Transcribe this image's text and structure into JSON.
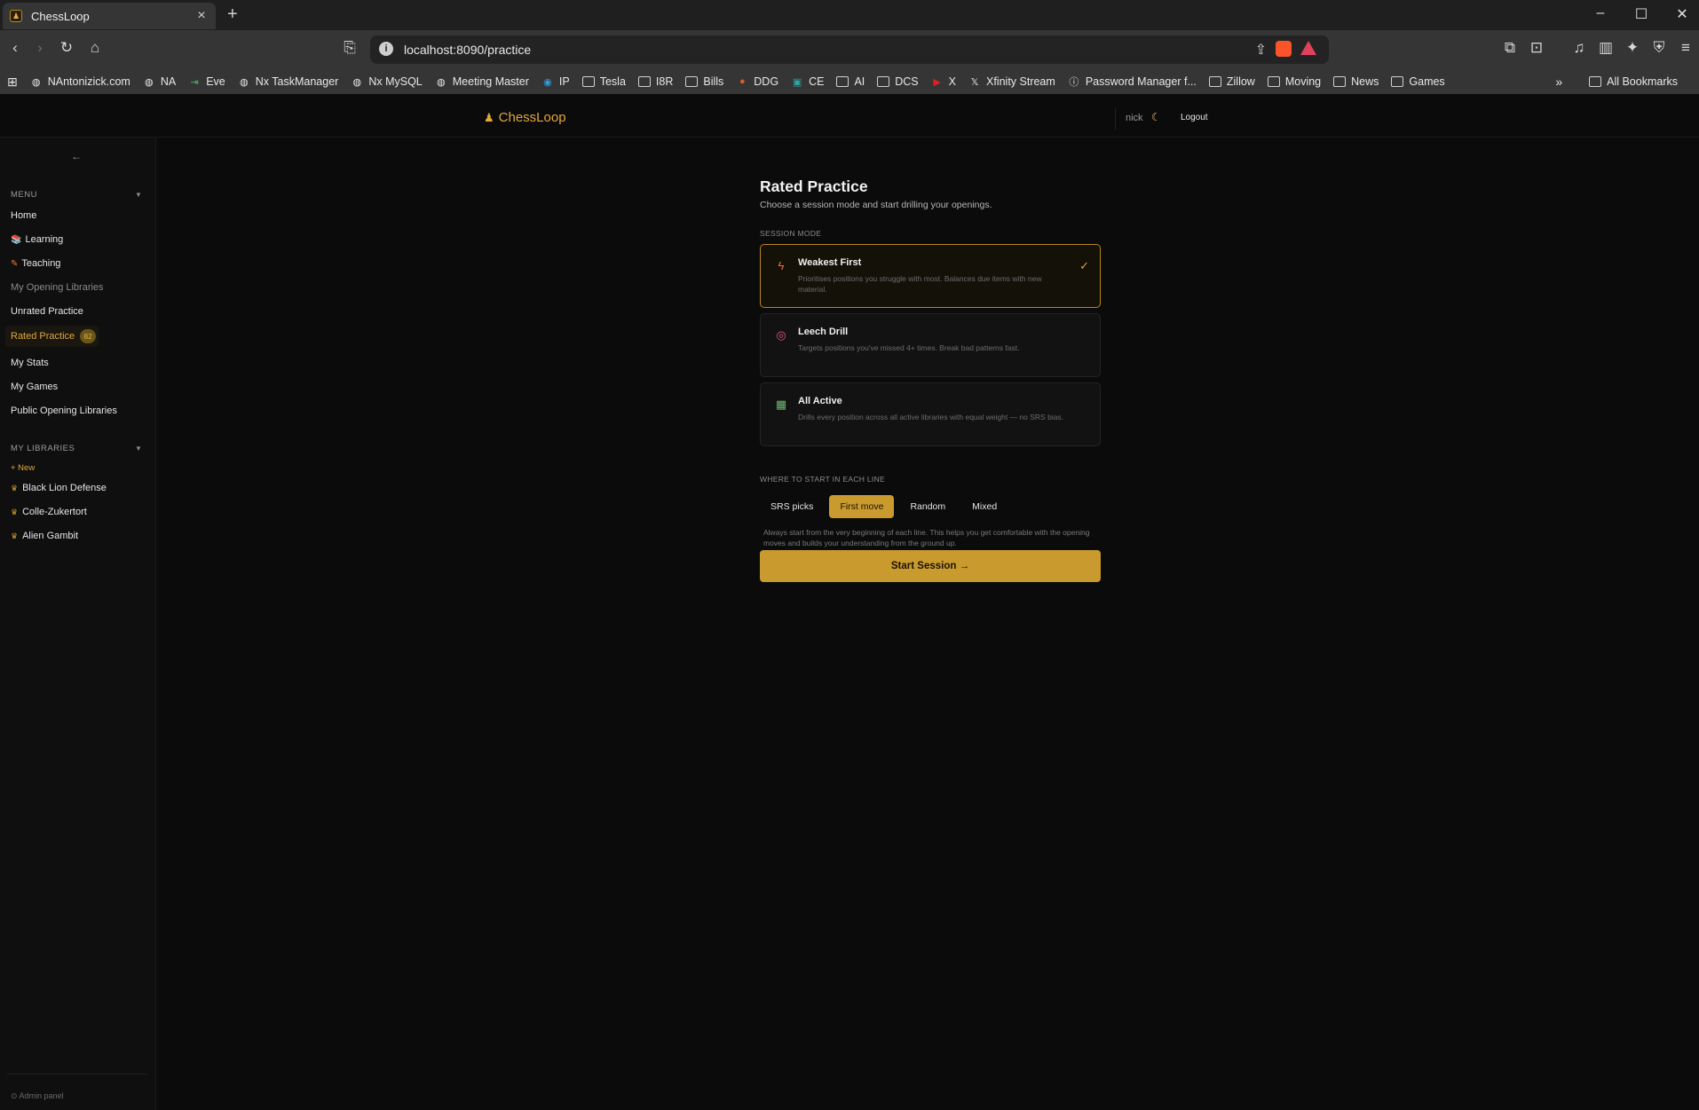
{
  "browser": {
    "tab_title": "ChessLoop",
    "url": "localhost:8090/practice",
    "bookmarks": [
      {
        "label": "NAntonizick.com",
        "icon": "globe-icon"
      },
      {
        "label": "NA",
        "icon": "globe-icon"
      },
      {
        "label": "Eve",
        "icon": "link-icon"
      },
      {
        "label": "Nx TaskManager",
        "icon": "globe-icon"
      },
      {
        "label": "Nx MySQL",
        "icon": "globe-icon"
      },
      {
        "label": "Meeting Master",
        "icon": "globe-icon"
      },
      {
        "label": "IP",
        "icon": "location-icon"
      },
      {
        "label": "Tesla",
        "icon": "folder-icon"
      },
      {
        "label": "I8R",
        "icon": "folder-icon"
      },
      {
        "label": "Bills",
        "icon": "folder-icon"
      },
      {
        "label": "DDG",
        "icon": "duck-icon"
      },
      {
        "label": "CE",
        "icon": "cw-icon"
      },
      {
        "label": "AI",
        "icon": "folder-icon"
      },
      {
        "label": "DCS",
        "icon": "folder-icon"
      },
      {
        "label": "X",
        "icon": "youtube-icon"
      },
      {
        "label": "Xfinity Stream",
        "icon": "x-icon"
      },
      {
        "label": "Password Manager f...",
        "icon": "info-icon"
      },
      {
        "label": "Zillow",
        "icon": "folder-icon"
      },
      {
        "label": "Moving",
        "icon": "folder-icon"
      },
      {
        "label": "News",
        "icon": "folder-icon"
      },
      {
        "label": "Games",
        "icon": "folder-icon"
      }
    ],
    "all_bookmarks": "All Bookmarks"
  },
  "header": {
    "brand": "ChessLoop",
    "user": "nick",
    "logout": "Logout"
  },
  "sidebar": {
    "collapse": "←",
    "menu_label": "MENU",
    "items": [
      {
        "label": "Home"
      },
      {
        "label": "Learning",
        "icon": "books-icon"
      },
      {
        "label": "Teaching",
        "icon": "pencil-icon"
      },
      {
        "label": "My Opening Libraries"
      },
      {
        "label": "Unrated Practice"
      },
      {
        "label": "Rated Practice",
        "badge": "82"
      },
      {
        "label": "My Stats"
      },
      {
        "label": "My Games"
      },
      {
        "label": "Public Opening Libraries"
      }
    ],
    "libraries_label": "MY LIBRARIES",
    "new_library": "+ New",
    "libraries": [
      "Black Lion Defense",
      "Colle-Zukertort",
      "Alien Gambit"
    ],
    "admin": "⊙ Admin panel"
  },
  "main": {
    "title": "Rated Practice",
    "subtitle": "Choose a session mode and start drilling your openings.",
    "session_mode_label": "SESSION MODE",
    "modes": [
      {
        "title": "Weakest First",
        "desc": "Prioritises positions you struggle with most. Balances due items with new material.",
        "icon": "lightning-icon",
        "selected": true
      },
      {
        "title": "Leech Drill",
        "desc": "Targets positions you've missed 4+ times. Break bad patterns fast.",
        "icon": "target-icon",
        "selected": false
      },
      {
        "title": "All Active",
        "desc": "Drills every position across all active libraries with equal weight — no SRS bias.",
        "icon": "squares-icon",
        "selected": false
      }
    ],
    "start_label": "WHERE TO START IN EACH LINE",
    "start_options": [
      "SRS picks",
      "First move",
      "Random",
      "Mixed"
    ],
    "start_selected": "First move",
    "hint": "Always start from the very beginning of each line. This helps you get comfortable with the opening moves and builds your understanding from the ground up.",
    "start_button": "Start Session →"
  },
  "colors": {
    "accent": "#c99a2e",
    "background": "#0b0b0b"
  }
}
